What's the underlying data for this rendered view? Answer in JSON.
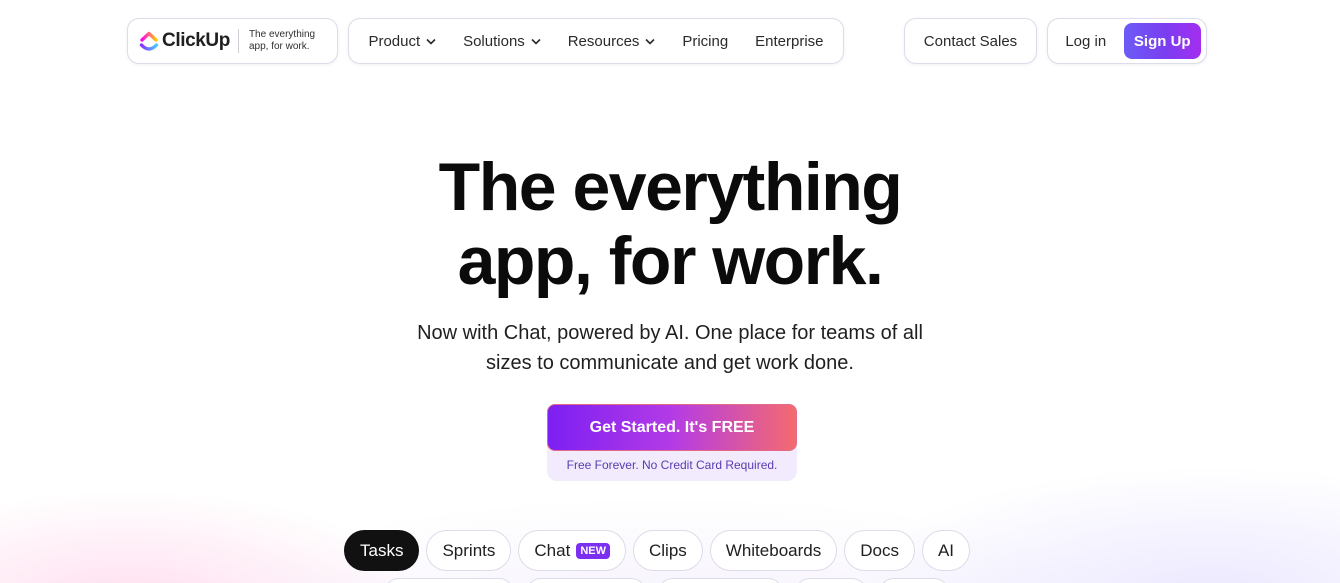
{
  "brand": {
    "name": "ClickUp",
    "tagline_line1": "The everything",
    "tagline_line2": "app, for work."
  },
  "nav": {
    "items": [
      {
        "label": "Product",
        "has_dropdown": true
      },
      {
        "label": "Solutions",
        "has_dropdown": true
      },
      {
        "label": "Resources",
        "has_dropdown": true
      },
      {
        "label": "Pricing",
        "has_dropdown": false
      },
      {
        "label": "Enterprise",
        "has_dropdown": false
      }
    ],
    "contact_label": "Contact Sales",
    "login_label": "Log in",
    "signup_label": "Sign Up"
  },
  "hero": {
    "title_line1": "The everything",
    "title_line2": "app, for work.",
    "subtitle_line1": "Now with Chat, powered by AI. One place for teams of all",
    "subtitle_line2": "sizes to communicate and get work done.",
    "cta_label": "Get Started. It's FREE",
    "cta_note": "Free Forever. No Credit Card Required."
  },
  "feature_tabs": [
    {
      "label": "Tasks",
      "active": true
    },
    {
      "label": "Sprints",
      "active": false
    },
    {
      "label": "Chat",
      "badge": "NEW",
      "active": false
    },
    {
      "label": "Clips",
      "active": false
    },
    {
      "label": "Whiteboards",
      "active": false
    },
    {
      "label": "Docs",
      "active": false
    },
    {
      "label": "AI",
      "active": false
    }
  ],
  "colors": {
    "signup_gradient": [
      "#6c5cf6",
      "#a42ef0"
    ],
    "cta_gradient": [
      "#7c1ff2",
      "#f46a6f"
    ],
    "badge": "#7b2ff0",
    "active_tab": "#111111"
  }
}
